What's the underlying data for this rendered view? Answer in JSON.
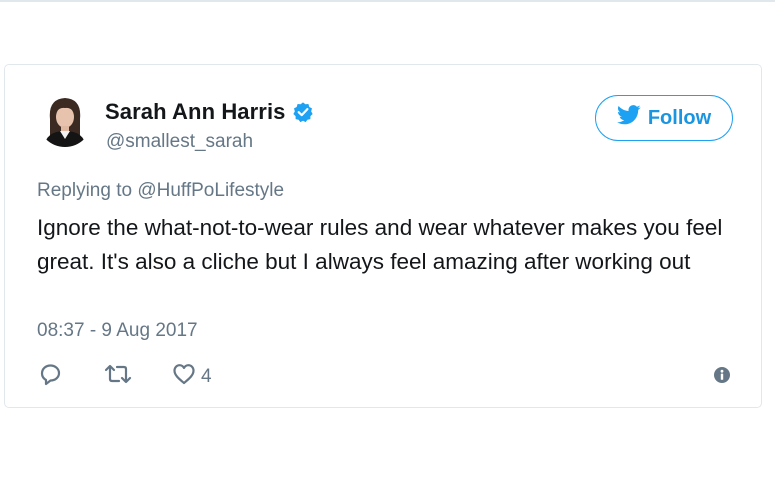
{
  "tweet": {
    "author": {
      "display_name": "Sarah Ann Harris",
      "handle": "@smallest_sarah",
      "verified": true
    },
    "follow_label": "Follow",
    "replying_prefix": "Replying to",
    "replying_to": "@HuffPoLifestyle",
    "text": "Ignore the what-not-to-wear rules and wear whatever makes you feel great. It's also a cliche but I always feel amazing after working out",
    "timestamp": "08:37 - 9 Aug 2017",
    "like_count": "4"
  },
  "icons": {
    "verified": "verified-badge-icon",
    "follow": "twitter-bird-icon",
    "reply": "reply-icon",
    "retweet": "retweet-icon",
    "like": "heart-icon",
    "info": "info-icon"
  },
  "colors": {
    "accent": "#1da1f2",
    "text": "#14171a",
    "muted": "#657786",
    "border": "#e1e8ed"
  }
}
